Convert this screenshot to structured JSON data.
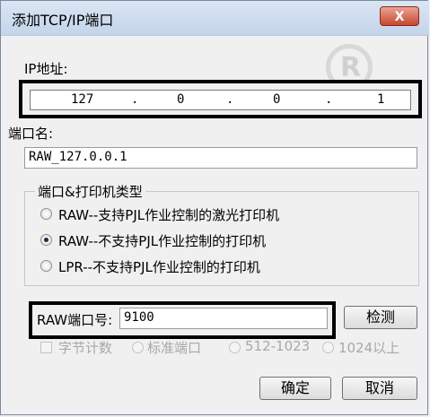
{
  "window": {
    "title": "添加TCP/IP端口",
    "close_glyph": "X"
  },
  "ip": {
    "label": "IP地址:",
    "octets": [
      "127",
      "0",
      "0",
      "1"
    ],
    "separator": "."
  },
  "port_name": {
    "label": "端口名:",
    "value": "RAW_127.0.0.1"
  },
  "port_type": {
    "title": "端口&打印机类型",
    "options": [
      {
        "label": "RAW--支持PJL作业控制的激光打印机",
        "selected": false
      },
      {
        "label": "RAW--不支持PJL作业控制的打印机",
        "selected": true
      },
      {
        "label": "LPR--不支持PJL作业控制的打印机",
        "selected": false
      }
    ]
  },
  "raw_port": {
    "label": "RAW端口号:",
    "value": "9100",
    "detect_button": "检测"
  },
  "byte_count": {
    "checkbox_label": "字节计数",
    "options": [
      "标准端口",
      "512-1023",
      "1024以上"
    ]
  },
  "footer": {
    "ok": "确定",
    "cancel": "取消"
  }
}
